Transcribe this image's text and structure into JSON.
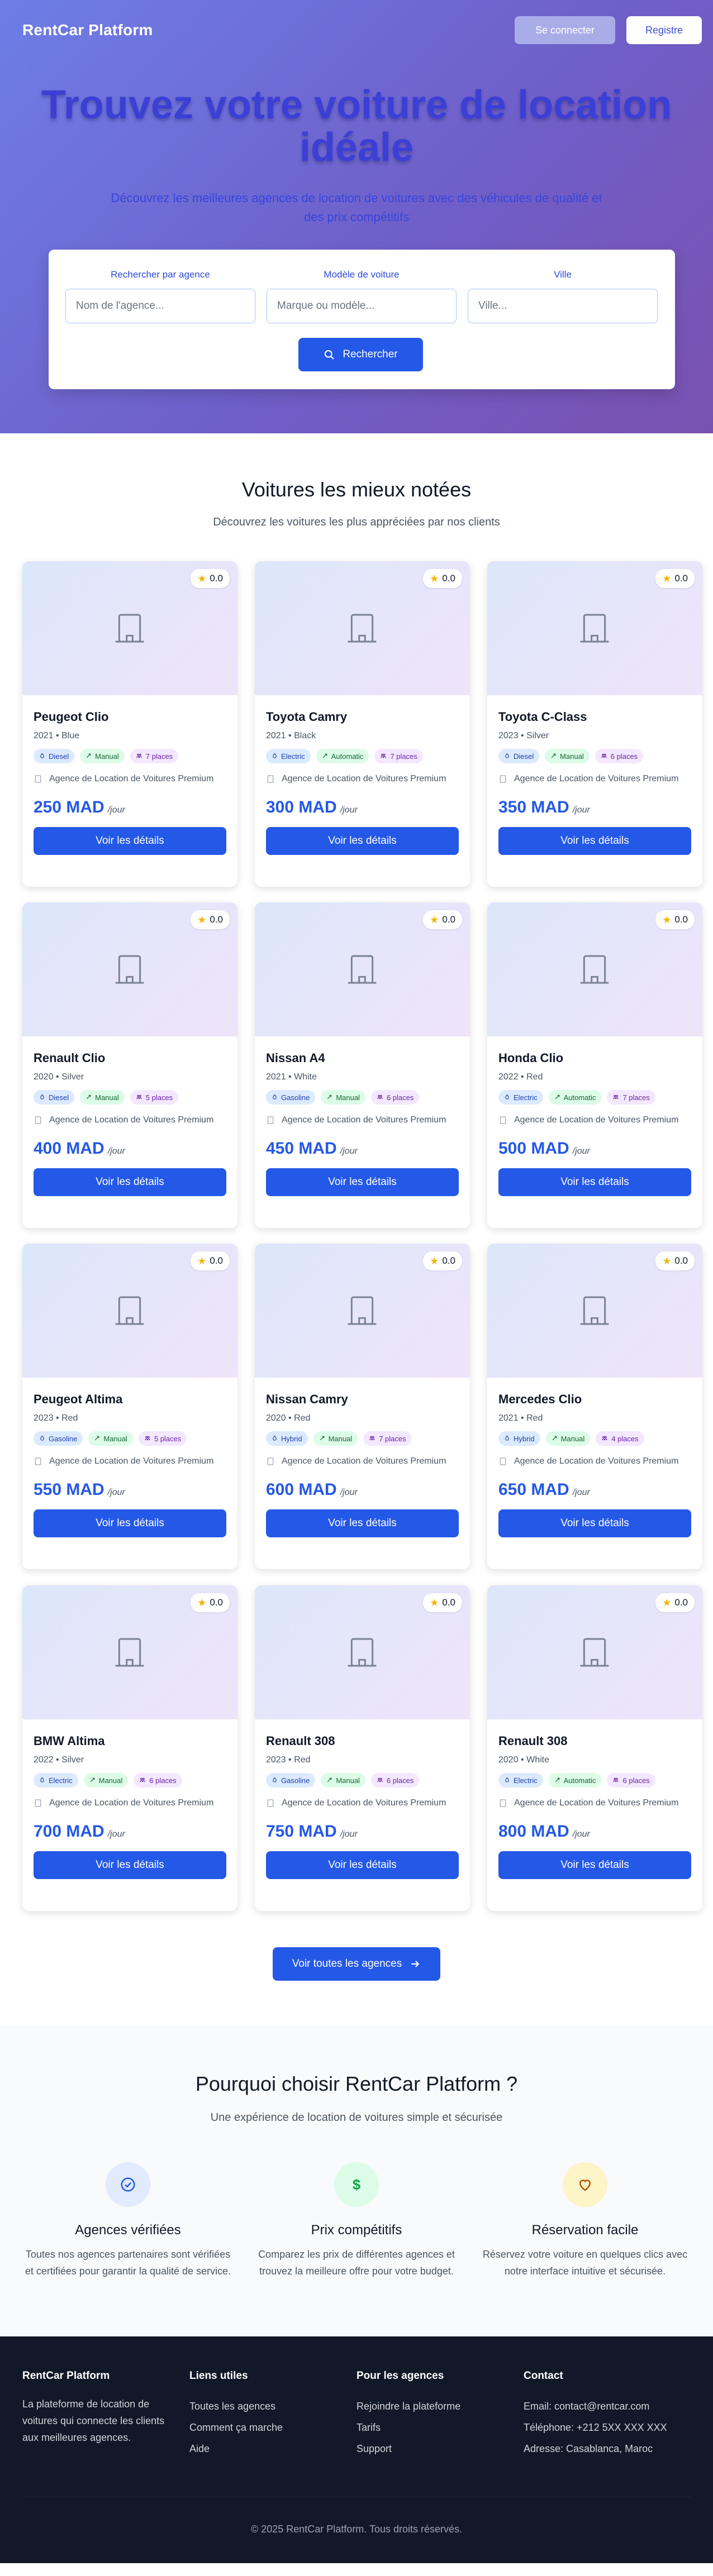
{
  "header": {
    "brand": "RentCar Platform",
    "login_label": "Se connecter",
    "register_label": "Registre"
  },
  "hero": {
    "title_line1": "Trouvez votre voiture de location",
    "title_line2": "idéale",
    "subtitle": "Découvrez les meilleures agences de location de voitures avec des véhicules de qualité et des prix compétitifs"
  },
  "search": {
    "agency_label": "Rechercher par agence",
    "agency_placeholder": "Nom de l'agence...",
    "model_label": "Modèle de voiture",
    "model_placeholder": "Marque ou modèle...",
    "city_label": "Ville",
    "city_placeholder": "Ville...",
    "button_label": "Rechercher"
  },
  "top_rated": {
    "title": "Voitures les mieux notées",
    "subtitle": "Découvrez les voitures les plus appréciées par nos clients",
    "per_day": "/jour",
    "details_label": "Voir les détails",
    "cars": [
      {
        "name": "Peugeot Clio",
        "year": "2021",
        "color": "Blue",
        "fuel": "Diesel",
        "transmission": "Manual",
        "seats": "7 places",
        "agency": "Agence de Location de Voitures Premium",
        "price": "250 MAD",
        "rating": "0.0"
      },
      {
        "name": "Toyota Camry",
        "year": "2021",
        "color": "Black",
        "fuel": "Electric",
        "transmission": "Automatic",
        "seats": "7 places",
        "agency": "Agence de Location de Voitures Premium",
        "price": "300 MAD",
        "rating": "0.0"
      },
      {
        "name": "Toyota C-Class",
        "year": "2023",
        "color": "Silver",
        "fuel": "Diesel",
        "transmission": "Manual",
        "seats": "6 places",
        "agency": "Agence de Location de Voitures Premium",
        "price": "350 MAD",
        "rating": "0.0"
      },
      {
        "name": "Renault Clio",
        "year": "2020",
        "color": "Silver",
        "fuel": "Diesel",
        "transmission": "Manual",
        "seats": "5 places",
        "agency": "Agence de Location de Voitures Premium",
        "price": "400 MAD",
        "rating": "0.0"
      },
      {
        "name": "Nissan A4",
        "year": "2021",
        "color": "White",
        "fuel": "Gasoline",
        "transmission": "Manual",
        "seats": "6 places",
        "agency": "Agence de Location de Voitures Premium",
        "price": "450 MAD",
        "rating": "0.0"
      },
      {
        "name": "Honda Clio",
        "year": "2022",
        "color": "Red",
        "fuel": "Electric",
        "transmission": "Automatic",
        "seats": "7 places",
        "agency": "Agence de Location de Voitures Premium",
        "price": "500 MAD",
        "rating": "0.0"
      },
      {
        "name": "Peugeot Altima",
        "year": "2023",
        "color": "Red",
        "fuel": "Gasoline",
        "transmission": "Manual",
        "seats": "5 places",
        "agency": "Agence de Location de Voitures Premium",
        "price": "550 MAD",
        "rating": "0.0"
      },
      {
        "name": "Nissan Camry",
        "year": "2020",
        "color": "Red",
        "fuel": "Hybrid",
        "transmission": "Manual",
        "seats": "7 places",
        "agency": "Agence de Location de Voitures Premium",
        "price": "600 MAD",
        "rating": "0.0"
      },
      {
        "name": "Mercedes Clio",
        "year": "2021",
        "color": "Red",
        "fuel": "Hybrid",
        "transmission": "Manual",
        "seats": "4 places",
        "agency": "Agence de Location de Voitures Premium",
        "price": "650 MAD",
        "rating": "0.0"
      },
      {
        "name": "BMW Altima",
        "year": "2022",
        "color": "Silver",
        "fuel": "Electric",
        "transmission": "Manual",
        "seats": "6 places",
        "agency": "Agence de Location de Voitures Premium",
        "price": "700 MAD",
        "rating": "0.0"
      },
      {
        "name": "Renault 308",
        "year": "2023",
        "color": "Red",
        "fuel": "Gasoline",
        "transmission": "Manual",
        "seats": "6 places",
        "agency": "Agence de Location de Voitures Premium",
        "price": "750 MAD",
        "rating": "0.0"
      },
      {
        "name": "Renault 308",
        "year": "2020",
        "color": "White",
        "fuel": "Electric",
        "transmission": "Automatic",
        "seats": "6 places",
        "agency": "Agence de Location de Voitures Premium",
        "price": "800 MAD",
        "rating": "0.0"
      }
    ],
    "all_agencies_label": "Voir toutes les agences"
  },
  "why": {
    "title": "Pourquoi choisir RentCar Platform ?",
    "subtitle": "Une expérience de location de voitures simple et sécurisée",
    "features": [
      {
        "icon": "check-circle-icon",
        "title": "Agences vérifiées",
        "text": "Toutes nos agences partenaires sont vérifiées et certifiées pour garantir la qualité de service."
      },
      {
        "icon": "dollar-icon",
        "title": "Prix compétitifs",
        "text": "Comparez les prix de différentes agences et trouvez la meilleure offre pour votre budget."
      },
      {
        "icon": "heart-icon",
        "title": "Réservation facile",
        "text": "Réservez votre voiture en quelques clics avec notre interface intuitive et sécurisée."
      }
    ]
  },
  "footer": {
    "brand_title": "RentCar Platform",
    "brand_text": "La plateforme de location de voitures qui connecte les clients aux meilleures agences.",
    "useful_title": "Liens utiles",
    "useful_links": [
      "Toutes les agences",
      "Comment ça marche",
      "Aide"
    ],
    "agencies_title": "Pour les agences",
    "agencies_links": [
      "Rejoindre la plateforme",
      "Tarifs",
      "Support"
    ],
    "contact_title": "Contact",
    "contact_lines": [
      "Email: contact@rentcar.com",
      "Téléphone: +212 5XX XXX XXX",
      "Adresse: Casablanca, Maroc"
    ],
    "copyright": "© 2025 RentCar Platform. Tous droits réservés."
  },
  "colors": {
    "primary": "#2458e6",
    "hero_start": "#6d7ee6",
    "hero_end": "#7a51b0",
    "footer_bg": "#111827",
    "rating_star": "#f5b400"
  }
}
